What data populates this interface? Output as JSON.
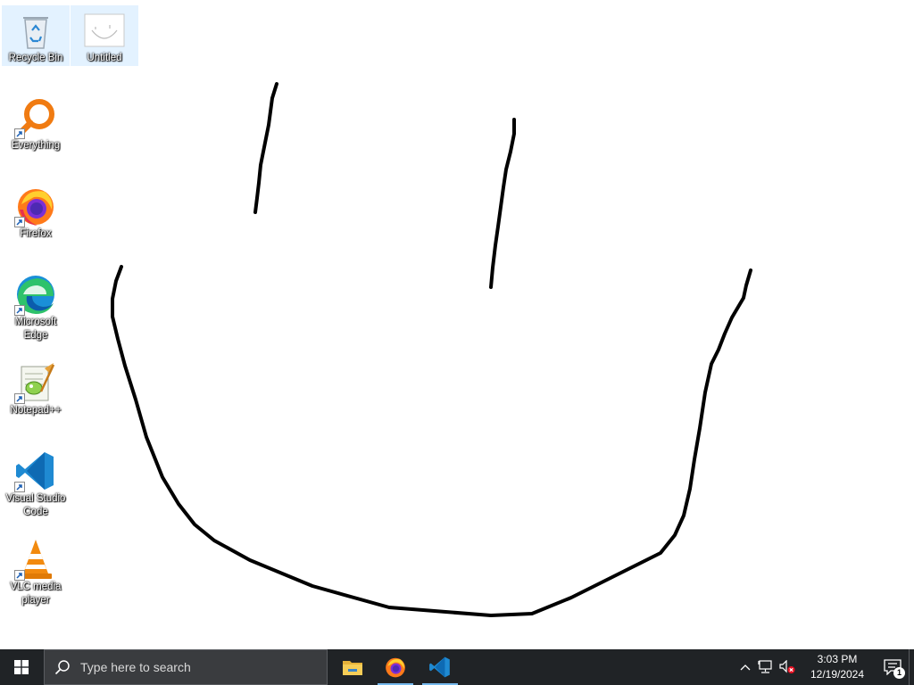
{
  "desktop": {
    "background_color": "#ffffff",
    "icons": [
      {
        "label": "Recycle Bin",
        "icon": "recycle-bin-icon"
      },
      {
        "label": "Untitled",
        "icon": "paint-image-icon"
      },
      {
        "label": "Everything",
        "icon": "everything-search-icon"
      },
      {
        "label": "Firefox",
        "icon": "firefox-icon"
      },
      {
        "label": "Microsoft Edge",
        "icon": "edge-icon"
      },
      {
        "label": "Notepad++",
        "icon": "notepad-plus-plus-icon"
      },
      {
        "label": "Visual Studio Code",
        "icon": "vscode-icon"
      },
      {
        "label": "VLC media player",
        "icon": "vlc-icon"
      }
    ],
    "drawing": {
      "description_icon": "smiley-face-drawing",
      "stroke_color": "#000000"
    }
  },
  "taskbar": {
    "background_color": "#202326",
    "start_icon": "windows-logo-icon",
    "search": {
      "placeholder": "Type here to search",
      "icon": "search-icon"
    },
    "pinned_apps": [
      {
        "name": "File Explorer",
        "icon": "file-explorer-icon",
        "running": false
      },
      {
        "name": "Firefox",
        "icon": "firefox-icon",
        "running": true
      },
      {
        "name": "Visual Studio Code",
        "icon": "vscode-icon",
        "running": true
      }
    ],
    "tray": {
      "chevron_icon": "chevron-up-icon",
      "network_icon": "network-icon",
      "volume_icon": "volume-muted-icon",
      "time": "3:03 PM",
      "date": "12/19/2024",
      "notifications_icon": "action-center-icon",
      "notification_count": "1"
    },
    "accent_color": "#76b9ed"
  }
}
